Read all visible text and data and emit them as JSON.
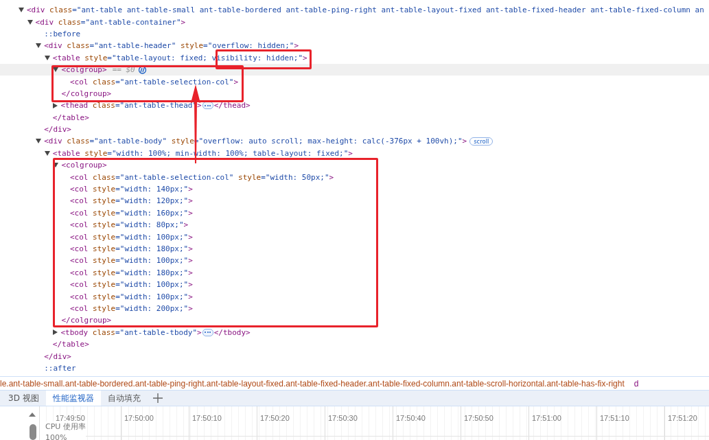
{
  "elements_tree": [
    {
      "kind": "element",
      "selected": false,
      "expanded": true,
      "parts": [
        {
          "kind": "tag",
          "text": "<div"
        },
        {
          "kind": "attr",
          "text": " class"
        },
        {
          "kind": "value",
          "text": "=\"ant-table ant-table-small ant-table-bordered ant-table-ping-right ant-table-layout-fixed ant-table-fixed-header ant-table-fixed-column an"
        }
      ],
      "children": [
        {
          "kind": "element",
          "selected": false,
          "expanded": true,
          "parts": [
            {
              "kind": "tag",
              "text": "<div"
            },
            {
              "kind": "attr",
              "text": " class"
            },
            {
              "kind": "value",
              "text": "=\"ant-table-container\""
            },
            {
              "kind": "tag",
              "text": ">"
            }
          ],
          "children": [
            {
              "kind": "pseudo",
              "selected": false,
              "text": "::before"
            },
            {
              "kind": "element",
              "selected": false,
              "expanded": true,
              "parts": [
                {
                  "kind": "tag",
                  "text": "<div"
                },
                {
                  "kind": "attr",
                  "text": " class"
                },
                {
                  "kind": "value",
                  "text": "=\"ant-table-header\""
                },
                {
                  "kind": "attr",
                  "text": " style"
                },
                {
                  "kind": "value",
                  "text": "=\"overflow: hidden;\""
                },
                {
                  "kind": "tag",
                  "text": ">"
                }
              ],
              "children": [
                {
                  "kind": "element",
                  "selected": false,
                  "expanded": true,
                  "parts": [
                    {
                      "kind": "tag",
                      "text": "<table"
                    },
                    {
                      "kind": "attr",
                      "text": " style"
                    },
                    {
                      "kind": "value",
                      "text": "=\"table-layout: fixed; visibility: hidden;\""
                    },
                    {
                      "kind": "tag",
                      "text": ">"
                    }
                  ],
                  "children": [
                    {
                      "kind": "element",
                      "selected": true,
                      "reference": "== $0",
                      "expanded": true,
                      "parts": [
                        {
                          "kind": "tag",
                          "text": "<colgroup>"
                        }
                      ],
                      "children": [
                        {
                          "kind": "leaf",
                          "selected": false,
                          "parts": [
                            {
                              "kind": "tag",
                              "text": "<col"
                            },
                            {
                              "kind": "attr",
                              "text": " class"
                            },
                            {
                              "kind": "value",
                              "text": "=\"ant-table-selection-col\""
                            },
                            {
                              "kind": "tag",
                              "text": ">"
                            }
                          ]
                        }
                      ],
                      "close": "</colgroup>"
                    },
                    {
                      "kind": "element",
                      "selected": false,
                      "expanded": false,
                      "parts": [
                        {
                          "kind": "tag",
                          "text": "<thead"
                        },
                        {
                          "kind": "attr",
                          "text": " class"
                        },
                        {
                          "kind": "value",
                          "text": "=\"ant-table-thead\""
                        },
                        {
                          "kind": "tag",
                          "text": ">"
                        }
                      ],
                      "close": "</thead>"
                    }
                  ],
                  "close": "</table>"
                }
              ],
              "close": "</div>"
            },
            {
              "kind": "element",
              "selected": false,
              "expanded": true,
              "badge": "scroll",
              "parts": [
                {
                  "kind": "tag",
                  "text": "<div"
                },
                {
                  "kind": "attr",
                  "text": " class"
                },
                {
                  "kind": "value",
                  "text": "=\"ant-table-body\""
                },
                {
                  "kind": "attr",
                  "text": " style"
                },
                {
                  "kind": "value",
                  "text": "=\"overflow: auto scroll; max-height: calc(-376px + 100vh);\""
                },
                {
                  "kind": "tag",
                  "text": ">"
                }
              ],
              "children": [
                {
                  "kind": "element",
                  "selected": false,
                  "expanded": true,
                  "parts": [
                    {
                      "kind": "tag",
                      "text": "<table"
                    },
                    {
                      "kind": "attr",
                      "text": " style"
                    },
                    {
                      "kind": "value",
                      "text": "=\"width: 100%; min-width: 100%; table-layout: fixed;\""
                    },
                    {
                      "kind": "tag",
                      "text": ">"
                    }
                  ],
                  "children": [
                    {
                      "kind": "element",
                      "selected": false,
                      "expanded": true,
                      "parts": [
                        {
                          "kind": "tag",
                          "text": "<colgroup>"
                        }
                      ],
                      "children": [
                        {
                          "kind": "leaf",
                          "selected": false,
                          "parts": [
                            {
                              "kind": "tag",
                              "text": "<col"
                            },
                            {
                              "kind": "attr",
                              "text": " class"
                            },
                            {
                              "kind": "value",
                              "text": "=\"ant-table-selection-col\""
                            },
                            {
                              "kind": "attr",
                              "text": " style"
                            },
                            {
                              "kind": "value",
                              "text": "=\"width: 50px;\""
                            },
                            {
                              "kind": "tag",
                              "text": ">"
                            }
                          ]
                        },
                        {
                          "kind": "leaf",
                          "selected": false,
                          "parts": [
                            {
                              "kind": "tag",
                              "text": "<col"
                            },
                            {
                              "kind": "attr",
                              "text": " style"
                            },
                            {
                              "kind": "value",
                              "text": "=\"width: 140px;\""
                            },
                            {
                              "kind": "tag",
                              "text": ">"
                            }
                          ]
                        },
                        {
                          "kind": "leaf",
                          "selected": false,
                          "parts": [
                            {
                              "kind": "tag",
                              "text": "<col"
                            },
                            {
                              "kind": "attr",
                              "text": " style"
                            },
                            {
                              "kind": "value",
                              "text": "=\"width: 120px;\""
                            },
                            {
                              "kind": "tag",
                              "text": ">"
                            }
                          ]
                        },
                        {
                          "kind": "leaf",
                          "selected": false,
                          "parts": [
                            {
                              "kind": "tag",
                              "text": "<col"
                            },
                            {
                              "kind": "attr",
                              "text": " style"
                            },
                            {
                              "kind": "value",
                              "text": "=\"width: 160px;\""
                            },
                            {
                              "kind": "tag",
                              "text": ">"
                            }
                          ]
                        },
                        {
                          "kind": "leaf",
                          "selected": false,
                          "parts": [
                            {
                              "kind": "tag",
                              "text": "<col"
                            },
                            {
                              "kind": "attr",
                              "text": " style"
                            },
                            {
                              "kind": "value",
                              "text": "=\"width: 80px;\""
                            },
                            {
                              "kind": "tag",
                              "text": ">"
                            }
                          ]
                        },
                        {
                          "kind": "leaf",
                          "selected": false,
                          "parts": [
                            {
                              "kind": "tag",
                              "text": "<col"
                            },
                            {
                              "kind": "attr",
                              "text": " style"
                            },
                            {
                              "kind": "value",
                              "text": "=\"width: 100px;\""
                            },
                            {
                              "kind": "tag",
                              "text": ">"
                            }
                          ]
                        },
                        {
                          "kind": "leaf",
                          "selected": false,
                          "parts": [
                            {
                              "kind": "tag",
                              "text": "<col"
                            },
                            {
                              "kind": "attr",
                              "text": " style"
                            },
                            {
                              "kind": "value",
                              "text": "=\"width: 180px;\""
                            },
                            {
                              "kind": "tag",
                              "text": ">"
                            }
                          ]
                        },
                        {
                          "kind": "leaf",
                          "selected": false,
                          "parts": [
                            {
                              "kind": "tag",
                              "text": "<col"
                            },
                            {
                              "kind": "attr",
                              "text": " style"
                            },
                            {
                              "kind": "value",
                              "text": "=\"width: 100px;\""
                            },
                            {
                              "kind": "tag",
                              "text": ">"
                            }
                          ]
                        },
                        {
                          "kind": "leaf",
                          "selected": false,
                          "parts": [
                            {
                              "kind": "tag",
                              "text": "<col"
                            },
                            {
                              "kind": "attr",
                              "text": " style"
                            },
                            {
                              "kind": "value",
                              "text": "=\"width: 180px;\""
                            },
                            {
                              "kind": "tag",
                              "text": ">"
                            }
                          ]
                        },
                        {
                          "kind": "leaf",
                          "selected": false,
                          "parts": [
                            {
                              "kind": "tag",
                              "text": "<col"
                            },
                            {
                              "kind": "attr",
                              "text": " style"
                            },
                            {
                              "kind": "value",
                              "text": "=\"width: 100px;\""
                            },
                            {
                              "kind": "tag",
                              "text": ">"
                            }
                          ]
                        },
                        {
                          "kind": "leaf",
                          "selected": false,
                          "parts": [
                            {
                              "kind": "tag",
                              "text": "<col"
                            },
                            {
                              "kind": "attr",
                              "text": " style"
                            },
                            {
                              "kind": "value",
                              "text": "=\"width: 100px;\""
                            },
                            {
                              "kind": "tag",
                              "text": ">"
                            }
                          ]
                        },
                        {
                          "kind": "leaf",
                          "selected": false,
                          "parts": [
                            {
                              "kind": "tag",
                              "text": "<col"
                            },
                            {
                              "kind": "attr",
                              "text": " style"
                            },
                            {
                              "kind": "value",
                              "text": "=\"width: 200px;\""
                            },
                            {
                              "kind": "tag",
                              "text": ">"
                            }
                          ]
                        }
                      ],
                      "close": "</colgroup>"
                    },
                    {
                      "kind": "element",
                      "selected": false,
                      "expanded": false,
                      "parts": [
                        {
                          "kind": "tag",
                          "text": "<tbody"
                        },
                        {
                          "kind": "attr",
                          "text": " class"
                        },
                        {
                          "kind": "value",
                          "text": "=\"ant-table-tbody\""
                        },
                        {
                          "kind": "tag",
                          "text": ">"
                        }
                      ],
                      "close": "</tbody>"
                    }
                  ],
                  "close": "</table>"
                }
              ],
              "close": "</div>"
            },
            {
              "kind": "pseudo",
              "selected": false,
              "text": "::after"
            }
          ]
        }
      ]
    }
  ],
  "breadcrumb": {
    "path": "le.ant-table-small.ant-table-bordered.ant-table-ping-right.ant-table-layout-fixed.ant-table-fixed-header.ant-table-fixed-column.ant-table-scroll-horizontal.ant-table-has-fix-right",
    "next": "d"
  },
  "drawer_tabs": [
    {
      "label": "3D 视图",
      "selected": false
    },
    {
      "label": "性能监视器",
      "selected": true
    },
    {
      "label": "自动填充",
      "selected": false
    }
  ],
  "performance": {
    "times": [
      "17:49:50",
      "17:50:00",
      "17:50:10",
      "17:50:20",
      "17:50:30",
      "17:50:40",
      "17:50:50",
      "17:51:00",
      "17:51:10",
      "17:51:20"
    ],
    "metric": "CPU 使用率",
    "scale": "100%"
  }
}
